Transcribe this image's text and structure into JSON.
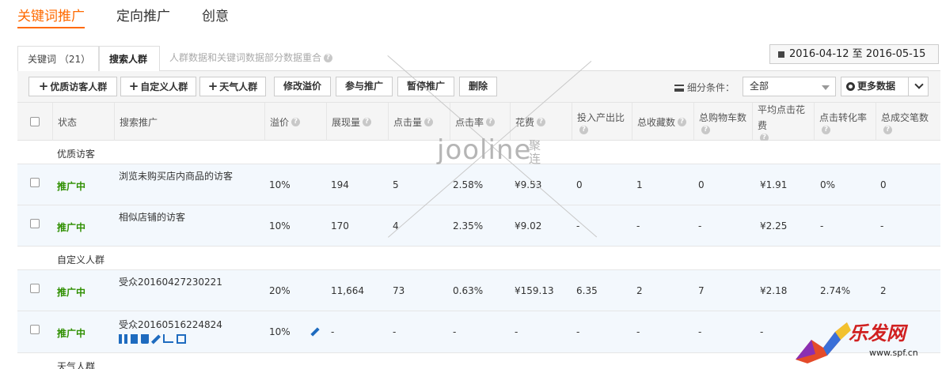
{
  "topnav": {
    "tabs": [
      "关键词推广",
      "定向推广",
      "创意"
    ]
  },
  "subtabs": {
    "keywords_label": "关键词 （21）",
    "crowd_label": "搜索人群",
    "note": "人群数据和关键词数据部分数据重合",
    "date_range": "2016-04-12 至 2016-05-15"
  },
  "toolbar": {
    "buttons": [
      "优质访客人群",
      "自定义人群",
      "天气人群",
      "修改溢价",
      "参与推广",
      "暂停推广",
      "删除"
    ],
    "filter_label": "细分条件：",
    "filter_value": "全部",
    "more_data": "更多数据"
  },
  "table": {
    "headers": [
      "状态",
      "搜索推广",
      "溢价",
      "展现量",
      "点击量",
      "点击率",
      "花费",
      "投入产出比",
      "总收藏数",
      "总购物车数",
      "平均点击花费",
      "点击转化率",
      "总成交笔数"
    ],
    "groups": [
      "优质访客",
      "自定义人群",
      "天气人群"
    ],
    "rows": [
      {
        "status": "推广中",
        "name": "浏览未购买店内商品的访客",
        "premium": "10%",
        "impressions": "194",
        "clicks": "5",
        "ctr": "2.58%",
        "cost": "¥9.53",
        "roi": "0",
        "favs": "1",
        "carts": "0",
        "cpc": "¥1.91",
        "cvr": "0%",
        "orders": "0"
      },
      {
        "status": "推广中",
        "name": "相似店铺的访客",
        "premium": "10%",
        "impressions": "170",
        "clicks": "4",
        "ctr": "2.35%",
        "cost": "¥9.02",
        "roi": "-",
        "favs": "-",
        "carts": "-",
        "cpc": "¥2.25",
        "cvr": "-",
        "orders": "-"
      },
      {
        "status": "推广中",
        "name": "受众20160427230221",
        "premium": "20%",
        "impressions": "11,664",
        "clicks": "73",
        "ctr": "0.63%",
        "cost": "¥159.13",
        "roi": "6.35",
        "favs": "2",
        "carts": "7",
        "cpc": "¥2.18",
        "cvr": "2.74%",
        "orders": "2"
      },
      {
        "status": "推广中",
        "name": "受众20160516224824",
        "premium": "10%",
        "impressions": "-",
        "clicks": "-",
        "ctr": "-",
        "cost": "-",
        "roi": "-",
        "favs": "-",
        "carts": "-",
        "cpc": "-",
        "cvr": "",
        "orders": ""
      }
    ]
  },
  "watermark": {
    "brand": "jooline",
    "brand_cn": "聚连",
    "logo_text": "乐发网",
    "logo_url": "www.spf.cn"
  },
  "colors": {
    "accent": "#ff6a00",
    "status_green": "#2f8f00",
    "row_blue": "#f3f8fd",
    "op_blue": "#1e6bbf"
  }
}
